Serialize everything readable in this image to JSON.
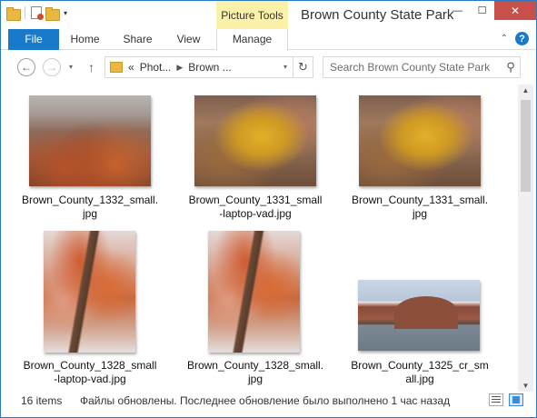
{
  "window": {
    "title": "Brown County State Park",
    "contextual_group": "Picture Tools",
    "min_glyph": "—",
    "max_glyph": "☐",
    "close_glyph": "✕"
  },
  "ribbon": {
    "tabs": [
      "File",
      "Home",
      "Share",
      "View",
      "Manage"
    ],
    "collapse_glyph": "⌃",
    "help_glyph": "?"
  },
  "nav": {
    "back_glyph": "←",
    "forward_glyph": "→",
    "up_glyph": "↑",
    "recent_glyph": "▾",
    "breadcrumbs": [
      "«",
      "Phot...",
      "Brown ..."
    ],
    "refresh_glyph": "↻",
    "search_placeholder": "Search Brown County State Park",
    "search_glyph": "⚲"
  },
  "files": [
    {
      "name_line1": "Brown_County_1332_small.",
      "name_line2": "jpg",
      "kind": "landscape"
    },
    {
      "name_line1": "Brown_County_1331_small",
      "name_line2": "-laptop-vad.jpg",
      "kind": "yellow"
    },
    {
      "name_line1": "Brown_County_1331_small.",
      "name_line2": "jpg",
      "kind": "yellow"
    },
    {
      "name_line1": "Brown_County_1328_small",
      "name_line2": "-laptop-vad.jpg",
      "kind": "tree"
    },
    {
      "name_line1": "Brown_County_1328_small.",
      "name_line2": "jpg",
      "kind": "tree"
    },
    {
      "name_line1": "Brown_County_1325_cr_sm",
      "name_line2": "all.jpg",
      "kind": "lake"
    }
  ],
  "status": {
    "item_count": "16 items",
    "message": "Файлы обновлены. Последнее обновление было выполнено 1 час назад"
  },
  "colors": {
    "accent": "#1979ca",
    "contextual": "#fbf1a8",
    "close": "#c7504a"
  }
}
